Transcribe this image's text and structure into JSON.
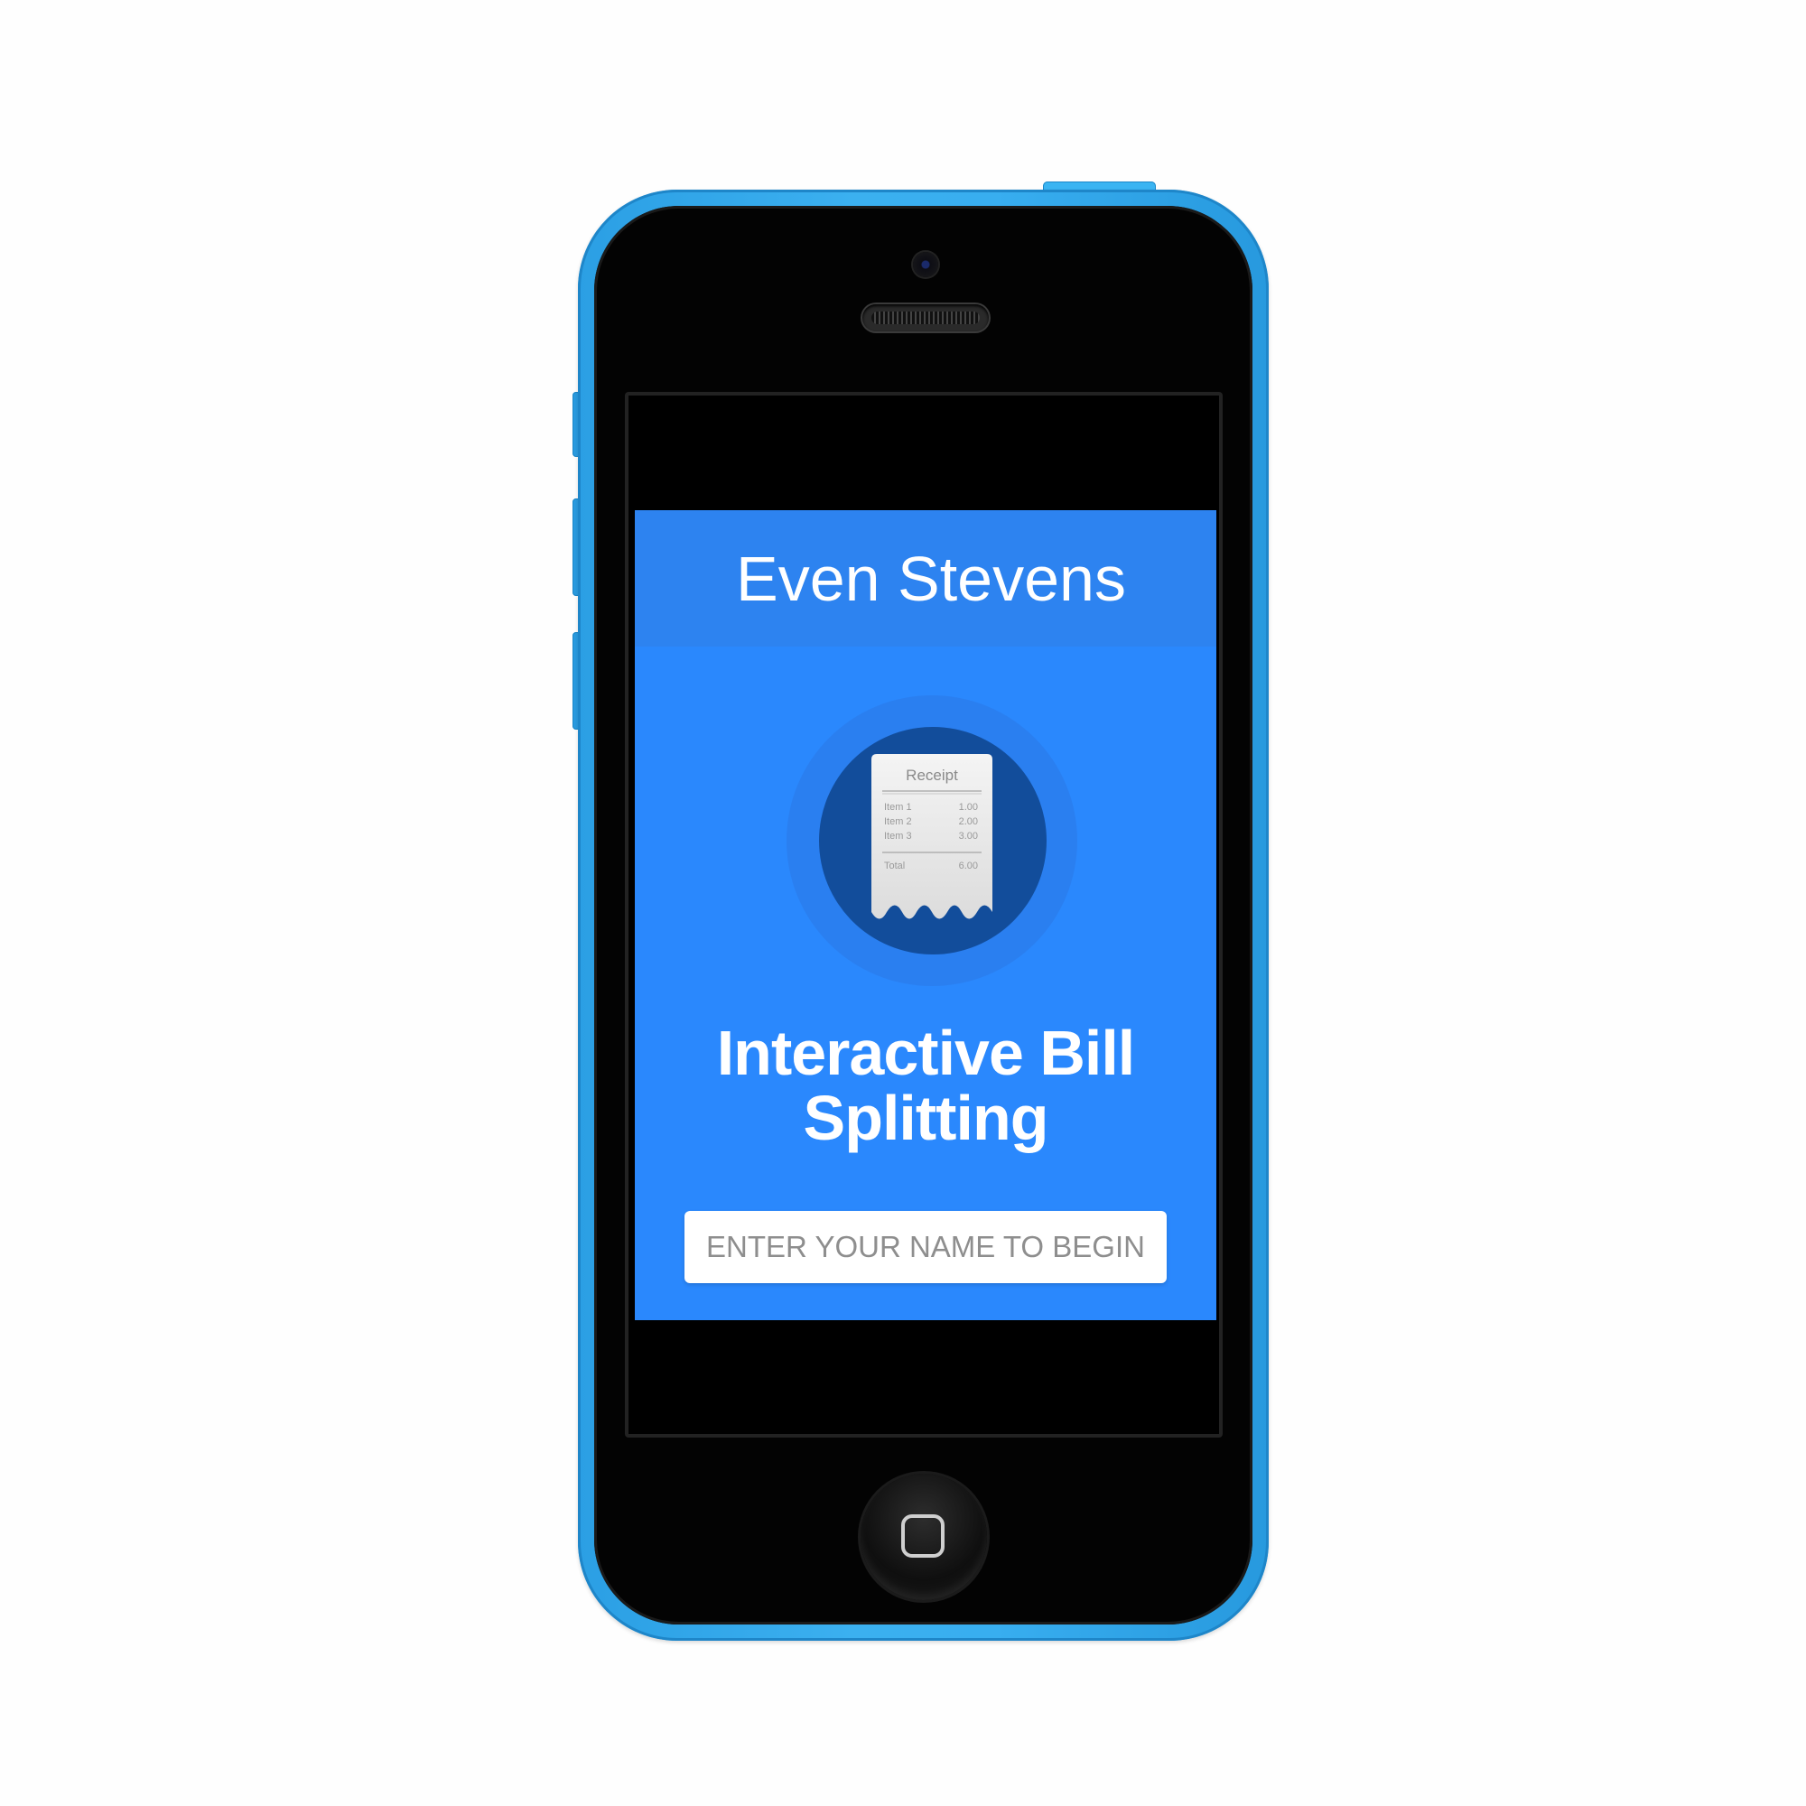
{
  "app": {
    "title": "Even Stevens",
    "headline_line1": "Interactive Bill",
    "headline_line2": "Splitting",
    "name_input": {
      "placeholder": "ENTER YOUR NAME TO BEGIN",
      "value": ""
    }
  },
  "receipt_icon": {
    "icon": "receipt-icon",
    "heading": "Receipt",
    "items": [
      {
        "label": "Item 1",
        "amount": "1.00"
      },
      {
        "label": "Item 2",
        "amount": "2.00"
      },
      {
        "label": "Item 3",
        "amount": "3.00"
      }
    ],
    "total_label": "Total",
    "total_amount": "6.00"
  },
  "colors": {
    "phone_body": "#38aef0",
    "app_background": "#2a88fd",
    "app_header": "#2d83f0",
    "icon_circle": "#124d9b",
    "text_primary": "#ffffff"
  }
}
